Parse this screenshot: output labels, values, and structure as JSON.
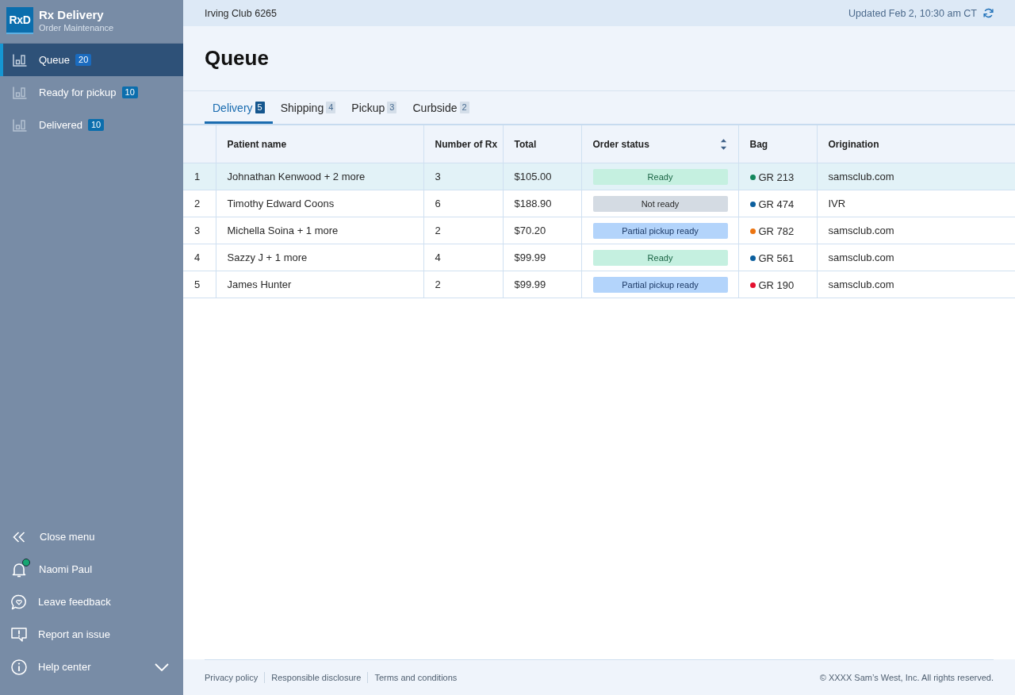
{
  "app": {
    "logo": "RxD",
    "title": "Rx Delivery",
    "subtitle": "Order Maintenance"
  },
  "sidebar": {
    "items": [
      {
        "label": "Queue",
        "count": "20",
        "selected": true
      },
      {
        "label": "Ready for pickup",
        "count": "10",
        "selected": false
      },
      {
        "label": "Delivered",
        "count": "10",
        "selected": false
      }
    ],
    "bottom_items": [
      {
        "kind": "close",
        "label": "Close menu"
      },
      {
        "kind": "notifications",
        "label": "Naomi Paul",
        "unread": true
      },
      {
        "kind": "feedback",
        "label": "Leave feedback"
      },
      {
        "kind": "report",
        "label": "Report an issue"
      },
      {
        "kind": "help",
        "label": "Help center",
        "expanded": false
      }
    ]
  },
  "top_bar": {
    "location": "Irving Club 6265",
    "updated": "Updated Feb 2, 10:30 am CT"
  },
  "page_title": "Queue",
  "tabs": [
    {
      "label": "Delivery",
      "count": "5",
      "selected": true
    },
    {
      "label": "Shipping",
      "count": "4",
      "selected": false
    },
    {
      "label": "Pickup",
      "count": "3",
      "selected": false
    },
    {
      "label": "Curbside",
      "count": "2",
      "selected": false
    }
  ],
  "table": {
    "columns": [
      {
        "label": "Patient name",
        "sortable": false
      },
      {
        "label": "Number of Rx",
        "sortable": false
      },
      {
        "label": "Total",
        "sortable": false
      },
      {
        "label": "Order status",
        "sortable": true
      },
      {
        "label": "Bag",
        "sortable": false
      },
      {
        "label": "Origination",
        "sortable": false
      }
    ],
    "rows": [
      {
        "number": "1",
        "patient": "Johnathan Kenwood + 2 more",
        "rx": "3",
        "total": "$105.00",
        "status": {
          "label": "Ready",
          "kind": "ready"
        },
        "bag": {
          "label": "GR 213",
          "color": "#12875c"
        },
        "origination": "samsclub.com",
        "selected": true
      },
      {
        "number": "2",
        "patient": "Timothy Edward Coons",
        "rx": "6",
        "total": "$188.90",
        "status": {
          "label": "Not ready",
          "kind": "not_ready"
        },
        "bag": {
          "label": "GR 474",
          "color": "#0b5f9e"
        },
        "origination": "IVR",
        "selected": false
      },
      {
        "number": "3",
        "patient": "Michella Soina + 1 more",
        "rx": "2",
        "total": "$70.20",
        "status": {
          "label": "Partial pickup ready",
          "kind": "partial"
        },
        "bag": {
          "label": "GR 782",
          "color": "#ec7410"
        },
        "origination": "samsclub.com",
        "selected": false
      },
      {
        "number": "4",
        "patient": "Sazzy J + 1 more",
        "rx": "4",
        "total": "$99.99",
        "status": {
          "label": "Ready",
          "kind": "ready"
        },
        "bag": {
          "label": "GR 561",
          "color": "#0b5f9e"
        },
        "origination": "samsclub.com",
        "selected": false
      },
      {
        "number": "5",
        "patient": "James Hunter",
        "rx": "2",
        "total": "$99.99",
        "status": {
          "label": "Partial pickup ready",
          "kind": "partial"
        },
        "bag": {
          "label": "GR 190",
          "color": "#e4102e"
        },
        "origination": "samsclub.com",
        "selected": false
      }
    ]
  },
  "footer": {
    "links": [
      "Privacy policy",
      "Responsible disclosure",
      "Terms and conditions"
    ],
    "copyright": "© XXXX Sam’s West, Inc. All rights reserved."
  }
}
